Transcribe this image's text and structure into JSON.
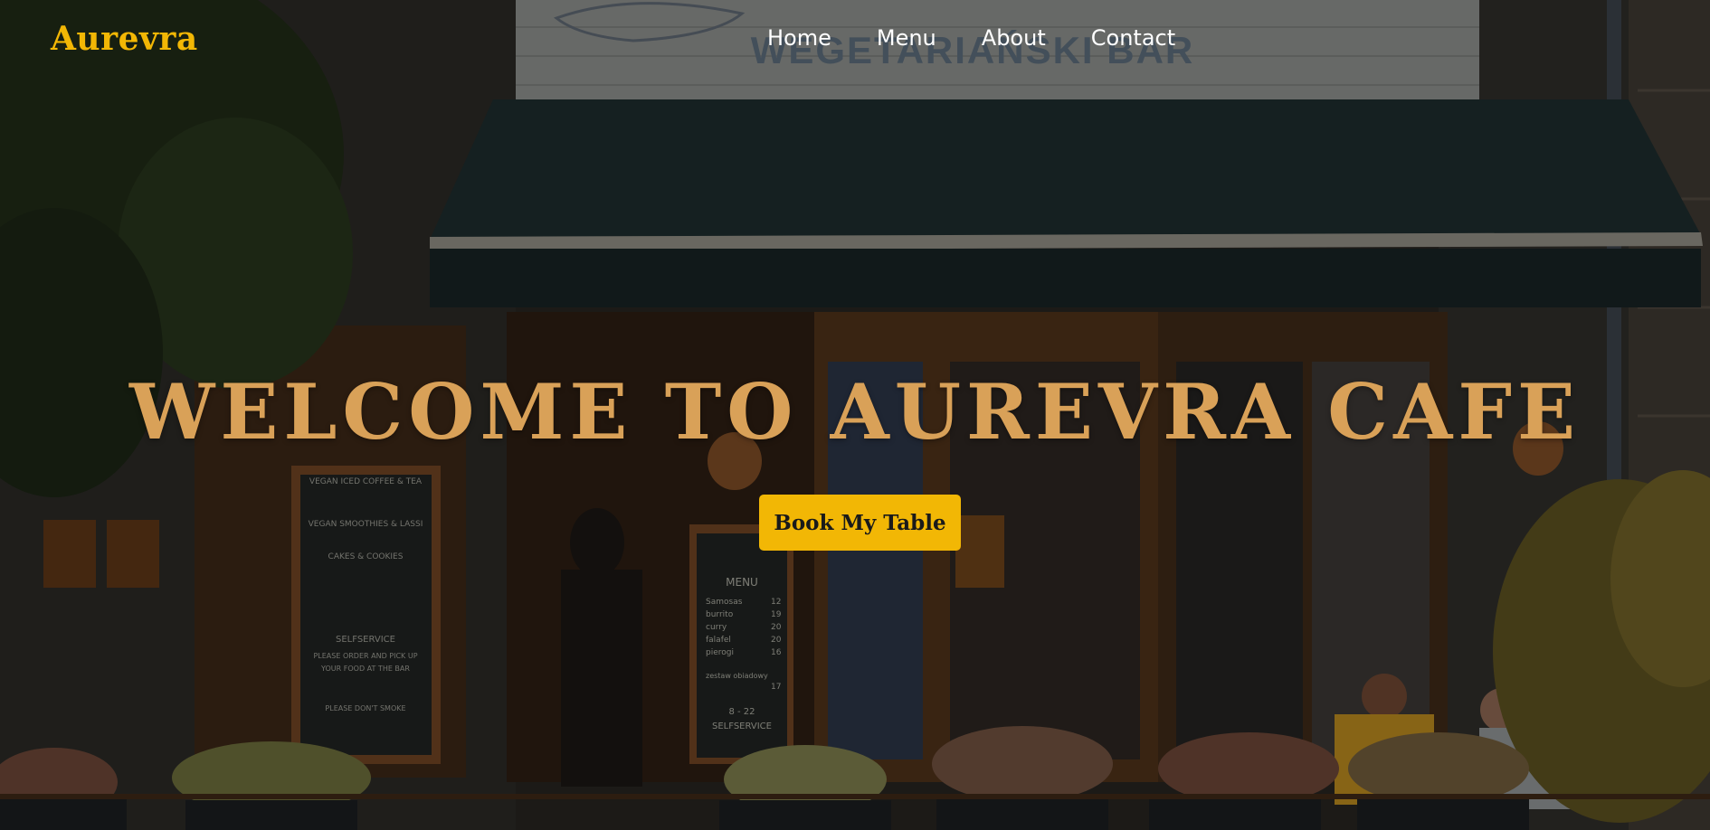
{
  "navbar": {
    "logo": "Aurevra",
    "links": [
      "Home",
      "Menu",
      "About",
      "Contact"
    ]
  },
  "hero": {
    "title": "WELCOME TO AUREVRA CAFE",
    "cta_label": "Book My Table",
    "background": {
      "sign_text": "WEGETARIAŃSKI BAR",
      "chalkboard_left": [
        "VEGAN ICED COFFEE & TEA",
        "VEGAN SMOOTHIES & LASSI",
        "CAKES & COOKIES",
        "SELFSERVICE",
        "PLEASE ORDER AND PICK UP",
        "YOUR FOOD AT THE BAR",
        "PLEASE DON'T SMOKE"
      ],
      "chalkboard_menu_title": "MENU",
      "chalkboard_menu": [
        {
          "item": "Samosas",
          "price": "12"
        },
        {
          "item": "burrito",
          "price": "19"
        },
        {
          "item": "curry",
          "price": "20"
        },
        {
          "item": "falafel",
          "price": "20"
        },
        {
          "item": "pierogi",
          "price": "16"
        },
        {
          "item": "zestaw obiadowy",
          "price": "17"
        }
      ],
      "chalkboard_menu_footer": [
        "8 - 22",
        "SELFSERVICE"
      ]
    }
  },
  "colors": {
    "accent": "#f2b705",
    "title": "#d9a158",
    "nav_text": "#ffffff",
    "awning": "#1d2b2c"
  }
}
